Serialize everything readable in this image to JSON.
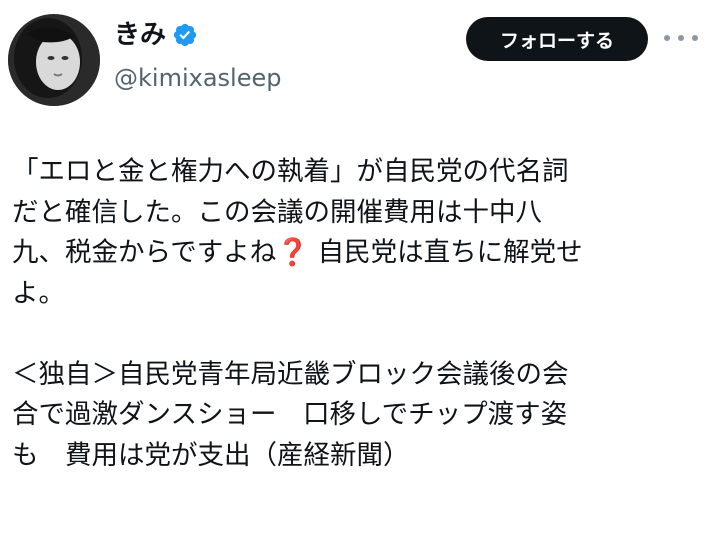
{
  "user": {
    "display_name": "きみ",
    "handle": "@kimixasleep",
    "verified": true
  },
  "actions": {
    "follow_label": "フォローする"
  },
  "tweet": {
    "lines": [
      "「エロと金と権力への執着」が自民党の代名詞",
      "だと確信した。この会議の開催費用は十中八",
      "九、税金からですよね",
      " 自民党は直ちに解党せ",
      "よ。",
      "＜独自＞自民党青年局近畿ブロック会議後の会",
      "合で過激ダンスショー　口移しでチップ渡す姿",
      "も　費用は党が支出（産経新聞）"
    ],
    "emoji": "❓"
  },
  "colors": {
    "follow_bg": "#0f1419",
    "verified": "#1d9bf0",
    "handle": "#536471",
    "emoji": "#d6182a"
  },
  "icons": {
    "verified": "verified-badge-icon",
    "more": "more-dots-icon"
  }
}
